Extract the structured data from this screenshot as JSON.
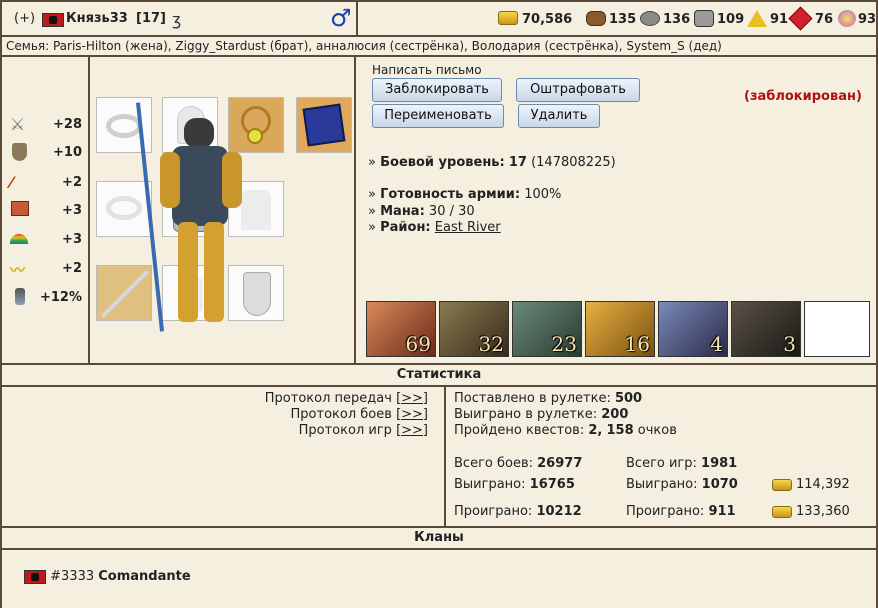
{
  "header": {
    "add_label": "(+)",
    "username": "Князь33",
    "level": "[17]",
    "gender_symbol": "♂",
    "resources": [
      {
        "name": "gold",
        "value": "70,586",
        "icon": "gold-icon"
      },
      {
        "name": "wood",
        "value": "135",
        "icon": "wood-icon"
      },
      {
        "name": "ore",
        "value": "136",
        "icon": "ore-icon"
      },
      {
        "name": "mercury",
        "value": "109",
        "icon": "mercury-icon"
      },
      {
        "name": "sulfur",
        "value": "91",
        "icon": "sulfur-icon"
      },
      {
        "name": "crystals",
        "value": "76",
        "icon": "crystal-icon"
      },
      {
        "name": "gems",
        "value": "93",
        "icon": "gems-icon"
      }
    ]
  },
  "family": {
    "text": "Семья: Paris-Hilton (жена), Ziggy_Stardust (брат), анналюсия (сестрёнка), Володария (сестрёнка), System_S (дед)"
  },
  "stats": [
    {
      "icon": "sword-icon",
      "value": "+28"
    },
    {
      "icon": "shield-icon",
      "value": "+10"
    },
    {
      "icon": "wand-icon",
      "value": "+2"
    },
    {
      "icon": "spellbook-icon",
      "value": "+3"
    },
    {
      "icon": "rainbow-icon",
      "value": "+3"
    },
    {
      "icon": "wings-icon",
      "value": "+2"
    },
    {
      "icon": "potion-icon",
      "value": "+12%"
    }
  ],
  "actions": {
    "write_letter": "Написать письмо",
    "block": "Заблокировать",
    "fine": "Оштрафовать",
    "rename": "Переименовать",
    "delete": "Удалить",
    "blocked_status": "(заблокирован)"
  },
  "info": {
    "combat_level_label": "Боевой уровень:",
    "combat_level": "17",
    "combat_exp": "(147808225)",
    "army_ready_label": "Готовность армии:",
    "army_ready": "100%",
    "mana_label": "Мана:",
    "mana": "30 / 30",
    "district_label": "Район:",
    "district": "East River",
    "bullet": "»"
  },
  "army": [
    {
      "count": "69",
      "name": "elf-unit",
      "color": "#a86a3e"
    },
    {
      "count": "32",
      "name": "ram-unit",
      "color": "#6e5a3a"
    },
    {
      "count": "23",
      "name": "lizard-unit",
      "color": "#4e6a5a"
    },
    {
      "count": "16",
      "name": "hydra-unit",
      "color": "#b8862e"
    },
    {
      "count": "4",
      "name": "witch-unit",
      "color": "#5a6a9a"
    },
    {
      "count": "3",
      "name": "dragon-unit",
      "color": "#3a3632"
    },
    {
      "count": "",
      "name": "empty-slot",
      "color": "#ffffff"
    }
  ],
  "statistics": {
    "title": "Статистика",
    "protocols": [
      {
        "label": "Протокол передач",
        "link": "[>>]"
      },
      {
        "label": "Протокол боев",
        "link": "[>>]"
      },
      {
        "label": "Протокол игр",
        "link": "[>>]"
      }
    ],
    "roulette_bet_label": "Поставлено в рулетке:",
    "roulette_bet": "500",
    "roulette_won_label": "Выиграно в рулетке:",
    "roulette_won": "200",
    "quests_label": "Пройдено квестов:",
    "quests": "2,",
    "quests_points": "158",
    "quests_points_label": "очков",
    "battles_total_label": "Всего боев:",
    "battles_total": "26977",
    "battles_won_label": "Выиграно:",
    "battles_won": "16765",
    "battles_lost_label": "Проиграно:",
    "battles_lost": "10212",
    "games_total_label": "Всего игр:",
    "games_total": "1981",
    "games_won_label": "Выиграно:",
    "games_won": "1070",
    "games_lost_label": "Проиграно:",
    "games_lost": "911",
    "gold_won": "114,392",
    "gold_lost": "133,360"
  },
  "clans": {
    "title": "Кланы",
    "items": [
      {
        "id": "#3333",
        "name": "Comandante"
      }
    ]
  }
}
